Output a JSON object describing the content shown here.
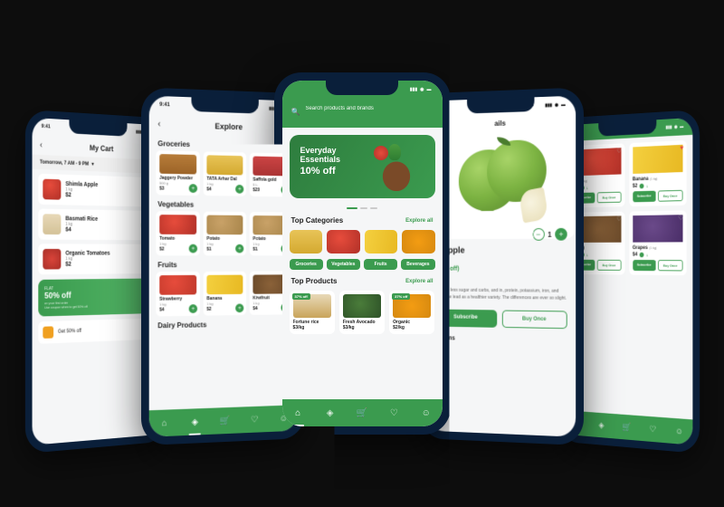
{
  "colors": {
    "primary": "#3b9b4f",
    "bg": "#0d0d0d",
    "frame": "#0a1f3a"
  },
  "status": {
    "time": "9:41"
  },
  "phone1": {
    "title": "My Cart",
    "slot": "Tomorrow, 7 AM - 9 PM",
    "items": [
      {
        "name": "Shimla Apple",
        "sub": "1 kg",
        "price": "$2"
      },
      {
        "name": "Basmati Rice",
        "sub": "1 kg",
        "price": "$4"
      },
      {
        "name": "Organic Tomatoes",
        "sub": "1 kg",
        "price": "$2"
      }
    ],
    "promo": {
      "flat": "FLAT",
      "big": "50% off",
      "sub": "on your first order",
      "sub2": "Use coupon when to get 50% off"
    },
    "coupon": "Get 50% off"
  },
  "phone2": {
    "title": "Explore",
    "sections": {
      "groceries": {
        "heading": "Groceries",
        "items": [
          {
            "name": "Jaggery Powder",
            "sub": "500 g",
            "price": "$3"
          },
          {
            "name": "TATA Arhar Dal",
            "sub": "1 kg",
            "price": "$4"
          },
          {
            "name": "Saffola gold",
            "sub": "5 L",
            "price": "$20"
          }
        ]
      },
      "vegetables": {
        "heading": "Vegetables",
        "items": [
          {
            "name": "Tomato",
            "sub": "1 kg",
            "price": "$2"
          },
          {
            "name": "Potato",
            "sub": "1 kg",
            "price": "$1"
          },
          {
            "name": "Potato",
            "sub": "1 kg",
            "price": "$1"
          }
        ]
      },
      "fruits": {
        "heading": "Fruits",
        "items": [
          {
            "name": "Strawberry",
            "sub": "1 kg",
            "price": "$4"
          },
          {
            "name": "Banana",
            "sub": "1 kg",
            "price": "$2"
          },
          {
            "name": "Kiwifruit",
            "sub": "1 kg",
            "price": "$4"
          }
        ]
      },
      "dairy": {
        "heading": "Dairy Products"
      }
    }
  },
  "phone3": {
    "search_placeholder": "Search products and brands",
    "hero": {
      "line1": "Everyday",
      "line2": "Essentials",
      "off": "10% off"
    },
    "categories": {
      "heading": "Top Categories",
      "link": "Explore all",
      "chips": [
        "Groceries",
        "Vegetables",
        "Fruits",
        "Beverages"
      ]
    },
    "products": {
      "heading": "Top Products",
      "link": "Explore all",
      "items": [
        {
          "badge": "37% off",
          "name": "Fortune rice",
          "price": "$3/kg"
        },
        {
          "name": "Fresh Avocado",
          "price": "$3/kg"
        },
        {
          "badge": "37% off",
          "name": "Organic",
          "price": "$2/kg"
        }
      ]
    }
  },
  "phone4": {
    "title_suffix": "ails",
    "name": "n Apple",
    "sub": "price",
    "qty": "1",
    "discount": "(42% off)",
    "desc_h": "ption",
    "desc": "es have less sugar and carbs, and in, protein, potassium, iron, and aking the lead as a healthier variety. The differences are ever so slight.",
    "subscribe": "Subscribe",
    "buy_once": "Buy Once",
    "related": "d items"
  },
  "phone5": {
    "items": [
      {
        "name": "rry",
        "unit": "(1 kg)",
        "price": "$4",
        "fav": false
      },
      {
        "name": "Banana",
        "unit": "(1 kg)",
        "price": "$2",
        "fav": true
      },
      {
        "name": "(1 kg)",
        "unit": "",
        "price": "$4",
        "fav": false
      },
      {
        "name": "Grapes",
        "unit": "(1 kg)",
        "price": "$4",
        "fav": false
      }
    ],
    "subscribe": "Subscribe",
    "buy_once": "Buy Once",
    "stock": "1"
  }
}
